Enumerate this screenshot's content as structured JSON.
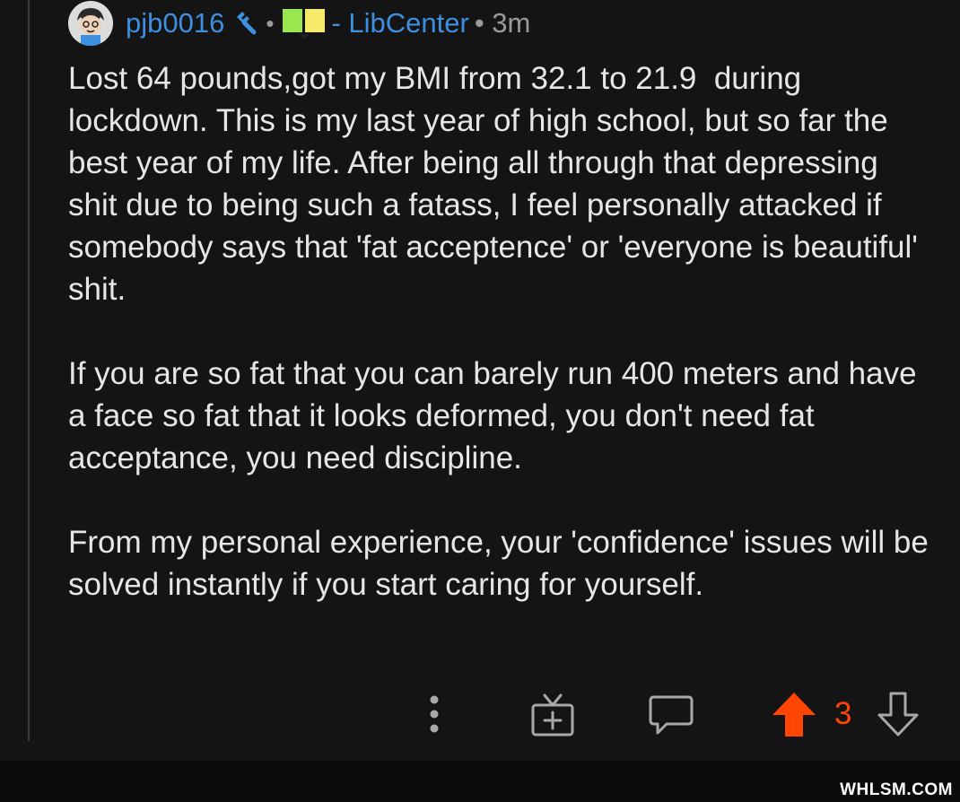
{
  "comment": {
    "username": "pjb0016",
    "separator": "•",
    "flair": "- LibCenter",
    "time": "• 3m",
    "paragraphs": [
      "Lost 64 pounds,got my BMI from 32.1 to 21.9  during lockdown. This is my last year of high school, but so far the best year of my life. After being all through that depressing shit due to being such a fatass, I feel personally attacked if somebody says that 'fat acceptence' or 'everyone is beautiful' shit.",
      "If you are so fat that you can barely run 400 meters and have a face so fat that it looks deformed, you don't need fat acceptance, you need discipline.",
      "From my personal experience, your 'confidence' issues will be solved instantly if you start caring for yourself."
    ]
  },
  "actions": {
    "score": "3",
    "icons": [
      "more-options-icon",
      "award-gift-icon",
      "reply-icon",
      "upvote-icon",
      "downvote-icon"
    ]
  },
  "colors": {
    "background": "#141414",
    "username": "#3d8fe0",
    "upvote": "#ff4500",
    "text": "#e6e6e6",
    "meta": "#9a9a9a"
  },
  "watermark": "WHLSM.COM"
}
